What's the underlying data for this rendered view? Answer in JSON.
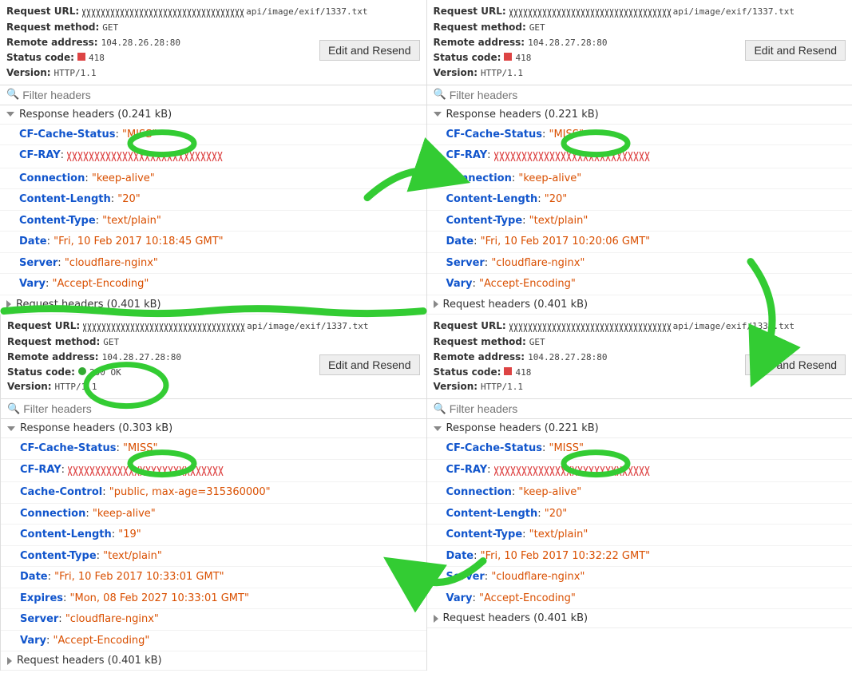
{
  "labels": {
    "request_url": "Request URL:",
    "request_method": "Request method:",
    "remote_address": "Remote address:",
    "status_code": "Status code:",
    "version": "Version:",
    "edit_resend": "Edit and Resend",
    "filter_placeholder": "Filter headers",
    "response_headers": "Response headers",
    "request_headers": "Request headers"
  },
  "panels": [
    {
      "url_suffix": "api/image/exif/1337.txt",
      "request_method": "GET",
      "remote_address": "104.28.26.28:80",
      "status_code": "418",
      "status_color": "red",
      "version": "HTTP/1.1",
      "response_size": "(0.241 kB)",
      "request_size": "(0.401 kB)",
      "headers": [
        {
          "name": "CF-Cache-Status",
          "value": "\"MISS\"",
          "circled": true
        },
        {
          "name": "CF-RAY",
          "value": "",
          "obscured": true
        },
        {
          "name": "Connection",
          "value": "\"keep-alive\""
        },
        {
          "name": "Content-Length",
          "value": "\"20\""
        },
        {
          "name": "Content-Type",
          "value": "\"text/plain\""
        },
        {
          "name": "Date",
          "value": "\"Fri, 10 Feb 2017 10:18:45 GMT\""
        },
        {
          "name": "Server",
          "value": "\"cloudflare-nginx\""
        },
        {
          "name": "Vary",
          "value": "\"Accept-Encoding\""
        }
      ]
    },
    {
      "url_suffix": "api/image/exif/1337.txt",
      "request_method": "GET",
      "remote_address": "104.28.27.28:80",
      "status_code": "418",
      "status_color": "red",
      "version": "HTTP/1.1",
      "response_size": "(0.221 kB)",
      "request_size": "(0.401 kB)",
      "headers": [
        {
          "name": "CF-Cache-Status",
          "value": "\"MISS\"",
          "circled": true
        },
        {
          "name": "CF-RAY",
          "value": "",
          "obscured": true
        },
        {
          "name": "Connection",
          "value": "\"keep-alive\""
        },
        {
          "name": "Content-Length",
          "value": "\"20\""
        },
        {
          "name": "Content-Type",
          "value": "\"text/plain\""
        },
        {
          "name": "Date",
          "value": "\"Fri, 10 Feb 2017 10:20:06 GMT\""
        },
        {
          "name": "Server",
          "value": "\"cloudflare-nginx\""
        },
        {
          "name": "Vary",
          "value": "\"Accept-Encoding\""
        }
      ]
    },
    {
      "url_suffix": "api/image/exif/1337.txt",
      "request_method": "GET",
      "remote_address": "104.28.27.28:80",
      "status_code": "200 OK",
      "status_color": "green",
      "version": "HTTP/1.1",
      "response_size": "(0.303 kB)",
      "request_size": "(0.401 kB)",
      "status_circled": true,
      "headers": [
        {
          "name": "CF-Cache-Status",
          "value": "\"MISS\"",
          "circled": true
        },
        {
          "name": "CF-RAY",
          "value": "",
          "obscured": true
        },
        {
          "name": "Cache-Control",
          "value": "\"public, max-age=315360000\""
        },
        {
          "name": "Connection",
          "value": "\"keep-alive\""
        },
        {
          "name": "Content-Length",
          "value": "\"19\""
        },
        {
          "name": "Content-Type",
          "value": "\"text/plain\""
        },
        {
          "name": "Date",
          "value": "\"Fri, 10 Feb 2017 10:33:01 GMT\""
        },
        {
          "name": "Expires",
          "value": "\"Mon, 08 Feb 2027 10:33:01 GMT\""
        },
        {
          "name": "Server",
          "value": "\"cloudflare-nginx\""
        },
        {
          "name": "Vary",
          "value": "\"Accept-Encoding\""
        }
      ]
    },
    {
      "url_suffix": "api/image/exif/1337.txt",
      "request_method": "GET",
      "remote_address": "104.28.27.28:80",
      "status_code": "418",
      "status_color": "red",
      "version": "HTTP/1.1",
      "response_size": "(0.221 kB)",
      "request_size": "(0.401 kB)",
      "headers": [
        {
          "name": "CF-Cache-Status",
          "value": "\"MISS\"",
          "circled": true
        },
        {
          "name": "CF-RAY",
          "value": "",
          "obscured": true
        },
        {
          "name": "Connection",
          "value": "\"keep-alive\""
        },
        {
          "name": "Content-Length",
          "value": "\"20\""
        },
        {
          "name": "Content-Type",
          "value": "\"text/plain\""
        },
        {
          "name": "Date",
          "value": "\"Fri, 10 Feb 2017 10:32:22 GMT\""
        },
        {
          "name": "Server",
          "value": "\"cloudflare-nginx\""
        },
        {
          "name": "Vary",
          "value": "\"Accept-Encoding\""
        }
      ]
    }
  ],
  "annotations": {
    "green_stroke": "#33cc33",
    "arrows": [
      "top-left-to-top-right",
      "top-right-to-bottom-right",
      "bottom-right-to-bottom-left"
    ],
    "separator_line": true
  }
}
